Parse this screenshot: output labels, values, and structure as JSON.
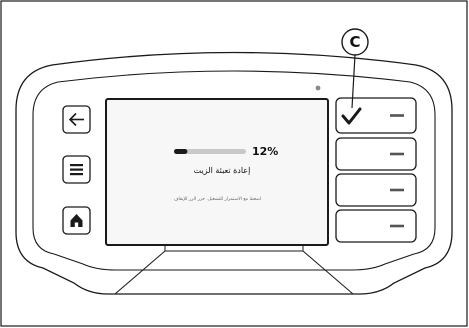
{
  "callout": {
    "letter": "C"
  },
  "screen": {
    "progress_percent": 12,
    "progress_label": "12%",
    "title": "إعادة تعبئة الزيت",
    "hint": "اضغط مع الاستمرار للتشغيل. حرر الزر للإيقاف"
  },
  "left_buttons": [
    {
      "icon": "back-arrow-icon"
    },
    {
      "icon": "menu-lines-icon"
    },
    {
      "icon": "home-icon"
    }
  ],
  "right_buttons": [
    {
      "icons": [
        "checkmark-icon",
        "dash-icon"
      ]
    },
    {
      "icons": [
        "dash-icon"
      ]
    },
    {
      "icons": [
        "dash-icon"
      ]
    },
    {
      "icons": [
        "dash-icon"
      ]
    }
  ],
  "colors": {
    "line": "#1a1a1a",
    "screen_fill": "#f7f7f7",
    "progress_track": "#c9c9c9",
    "progress_fill": "#1a1a1a",
    "indicator_dot": "#8a8a8a"
  }
}
